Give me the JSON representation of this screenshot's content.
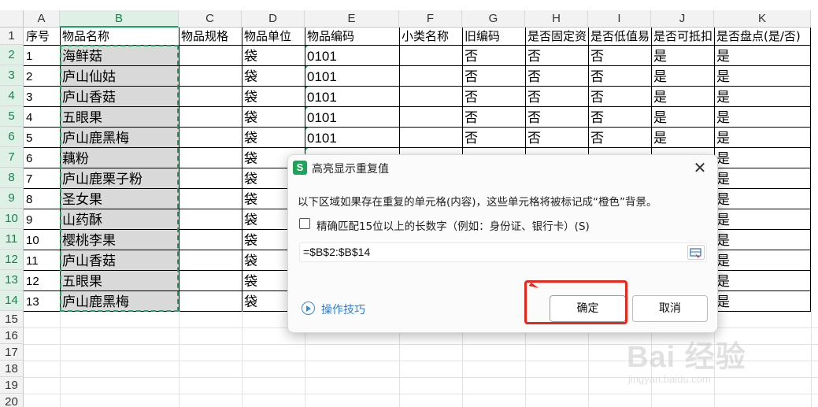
{
  "columns": [
    "A",
    "B",
    "C",
    "D",
    "E",
    "F",
    "G",
    "H",
    "I",
    "J",
    "K"
  ],
  "header_row": [
    "序号",
    "物品名称",
    "物品规格",
    "物品单位",
    "物品编码",
    "小类名称",
    "旧编码",
    "是否固定资",
    "是否低值易",
    "是否可抵扣",
    "是否盘点(是/否)"
  ],
  "rows": [
    {
      "num": "1",
      "name": "海鲜菇",
      "unit": "袋",
      "code": "0101",
      "g": "否",
      "h": "否",
      "i": "否",
      "j": "是",
      "k": "是"
    },
    {
      "num": "2",
      "name": "庐山仙姑",
      "unit": "袋",
      "code": "0101",
      "g": "否",
      "h": "否",
      "i": "否",
      "j": "是",
      "k": "是"
    },
    {
      "num": "3",
      "name": "庐山香菇",
      "unit": "袋",
      "code": "0101",
      "g": "否",
      "h": "否",
      "i": "否",
      "j": "是",
      "k": "是"
    },
    {
      "num": "4",
      "name": "五眼果",
      "unit": "袋",
      "code": "0101",
      "g": "否",
      "h": "否",
      "i": "否",
      "j": "是",
      "k": "是"
    },
    {
      "num": "5",
      "name": "庐山鹿黑梅",
      "unit": "袋",
      "code": "0101",
      "g": "否",
      "h": "否",
      "i": "否",
      "j": "是",
      "k": "是"
    },
    {
      "num": "6",
      "name": "藕粉",
      "unit": "袋",
      "code": "",
      "g": "",
      "h": "",
      "i": "",
      "j": "",
      "k": "是"
    },
    {
      "num": "7",
      "name": "庐山鹿栗子粉",
      "unit": "袋",
      "code": "",
      "g": "",
      "h": "",
      "i": "",
      "j": "",
      "k": "是"
    },
    {
      "num": "8",
      "name": "圣女果",
      "unit": "袋",
      "code": "",
      "g": "",
      "h": "",
      "i": "",
      "j": "",
      "k": "是"
    },
    {
      "num": "9",
      "name": "山药酥",
      "unit": "袋",
      "code": "",
      "g": "",
      "h": "",
      "i": "",
      "j": "",
      "k": "是"
    },
    {
      "num": "10",
      "name": "樱桃李果",
      "unit": "袋",
      "code": "",
      "g": "",
      "h": "",
      "i": "",
      "j": "",
      "k": "是"
    },
    {
      "num": "11",
      "name": "庐山香菇",
      "unit": "袋",
      "code": "",
      "g": "",
      "h": "",
      "i": "",
      "j": "",
      "k": "是"
    },
    {
      "num": "12",
      "name": "五眼果",
      "unit": "袋",
      "code": "",
      "g": "",
      "h": "",
      "i": "",
      "j": "",
      "k": "是"
    },
    {
      "num": "13",
      "name": "庐山鹿黑梅",
      "unit": "袋",
      "code": "",
      "g": "",
      "h": "",
      "i": "",
      "j": "",
      "k": "是"
    }
  ],
  "row_numbers": [
    "1",
    "2",
    "3",
    "4",
    "5",
    "6",
    "7",
    "8",
    "9",
    "10",
    "11",
    "12",
    "13",
    "14",
    "15",
    "16",
    "17",
    "18",
    "19",
    "20"
  ],
  "dialog": {
    "title": "高亮显示重复值",
    "description": "以下区域如果存在重复的单元格(内容)，这些单元格将被标记成“橙色”背景。",
    "checkbox_label": "精确匹配15位以上的长数字（例如：身份证、银行卡）(S)",
    "range_value": "=$B$2:$B$14",
    "tips_label": "操作技巧",
    "ok_label": "确定",
    "cancel_label": "取消",
    "close_symbol": "✕",
    "app_icon_letter": "S"
  },
  "watermark": {
    "brand": "Bai 经验",
    "url": "jingyan.baidu.com"
  },
  "colors": {
    "selection_accent": "#21a366",
    "highlight_box": "#e8281c",
    "link": "#2e7fd0"
  }
}
